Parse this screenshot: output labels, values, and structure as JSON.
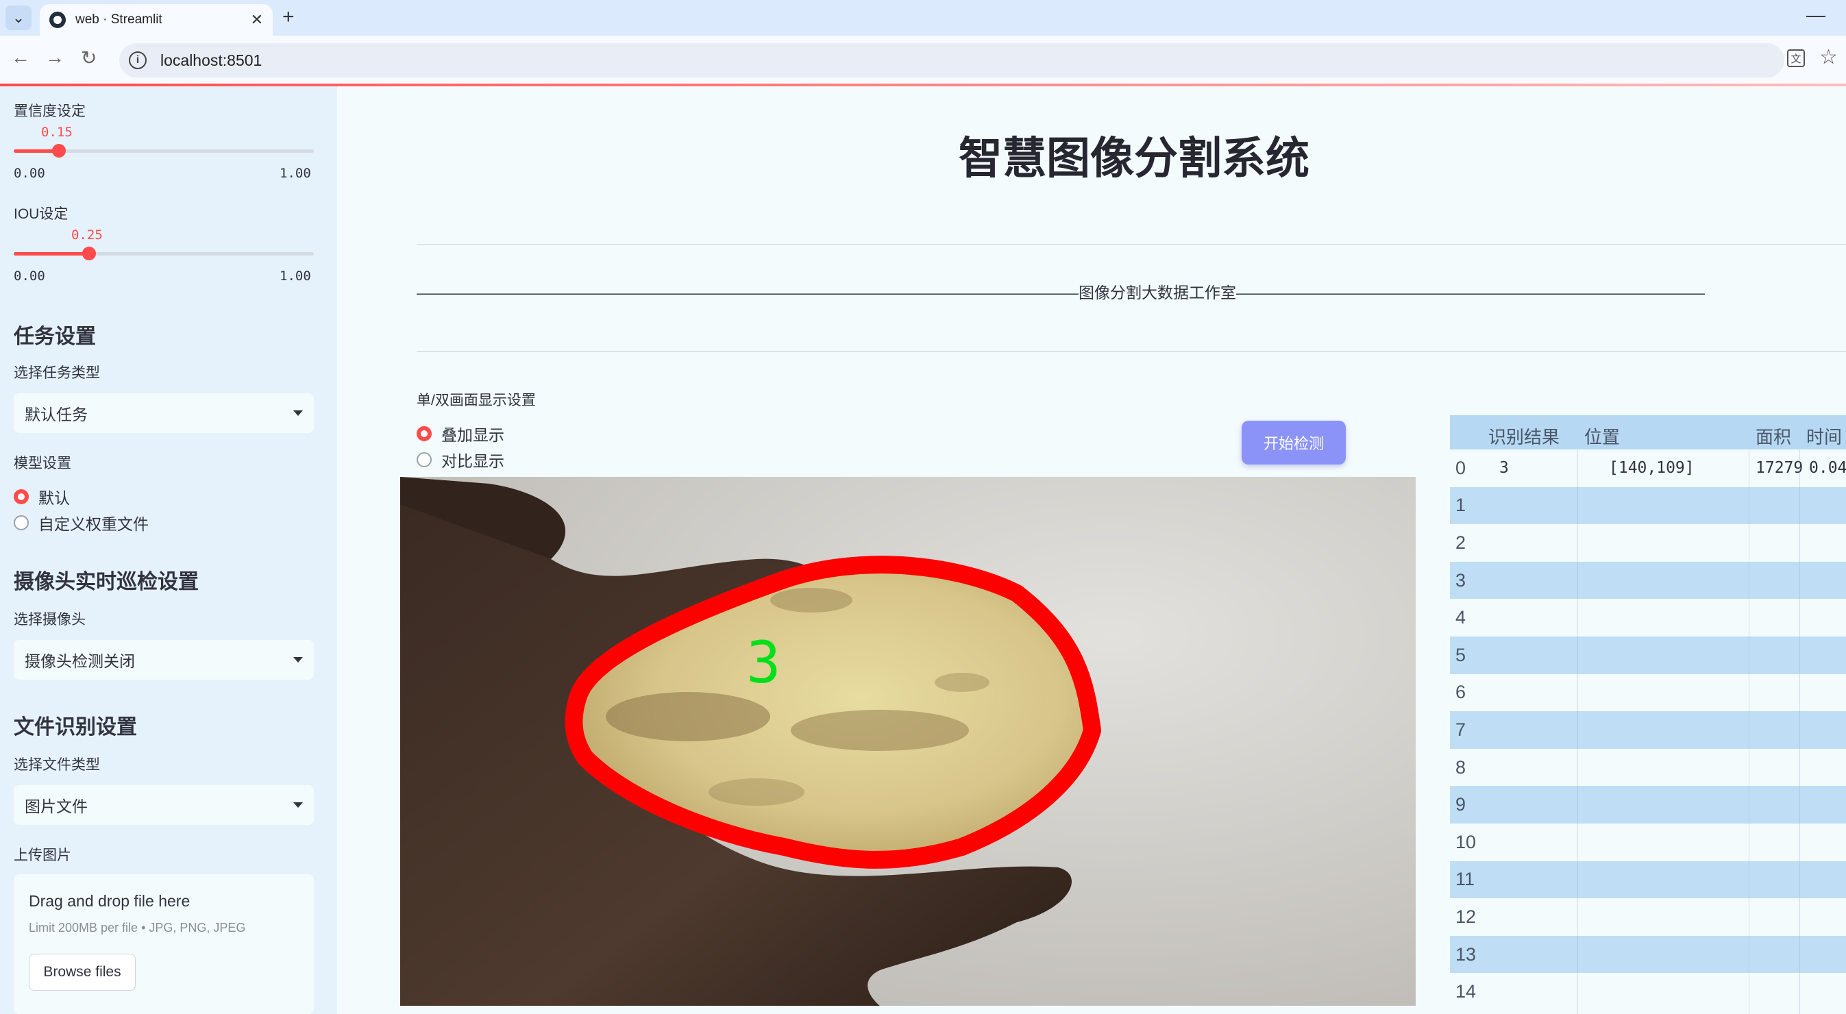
{
  "browser": {
    "tab_title": "web · Streamlit",
    "url": "localhost:8501"
  },
  "sidebar": {
    "confidence": {
      "label": "置信度设定",
      "value": "0.15",
      "min": "0.00",
      "max": "1.00",
      "fraction": 0.15
    },
    "iou": {
      "label": "IOU设定",
      "value": "0.25",
      "min": "0.00",
      "max": "1.00",
      "fraction": 0.25
    },
    "task": {
      "heading": "任务设置",
      "select_label": "选择任务类型",
      "selected": "默认任务"
    },
    "model": {
      "label": "模型设置",
      "options": [
        "默认",
        "自定义权重文件"
      ],
      "selected_index": 0
    },
    "camera": {
      "heading": "摄像头实时巡检设置",
      "select_label": "选择摄像头",
      "selected": "摄像头检测关闭"
    },
    "file": {
      "heading": "文件识别设置",
      "select_label": "选择文件类型",
      "selected": "图片文件"
    },
    "upload": {
      "label": "上传图片",
      "title": "Drag and drop file here",
      "limit": "Limit 200MB per file • JPG, PNG, JPEG",
      "button": "Browse files"
    }
  },
  "main": {
    "title": "智慧图像分割系统",
    "studio_line": "——————————————————————————————————————————图像分割大数据工作室——————————————————————————————————————————",
    "display": {
      "label": "单/双画面显示设置",
      "options": [
        "叠加显示",
        "对比显示"
      ],
      "selected_index": 0
    },
    "start_button": "开始检测",
    "detection_label": "3"
  },
  "table": {
    "headers": [
      "识别结果",
      "位置",
      "面积",
      "时间"
    ],
    "row_indices": [
      "0",
      "1",
      "2",
      "3",
      "4",
      "5",
      "6",
      "7",
      "8",
      "9",
      "10",
      "11",
      "12",
      "13",
      "14"
    ],
    "rows": [
      {
        "result": "3",
        "position": "[140,109]",
        "area": "17279",
        "time": "0.04"
      }
    ]
  },
  "colors": {
    "accent": "#ff4b4b",
    "sidebar_bg": "#e6f2fb",
    "button_bg": "#8b93f8",
    "table_stripe": "#bfdef6",
    "mask_outline": "#ff0000",
    "label_green": "#00e01a"
  }
}
